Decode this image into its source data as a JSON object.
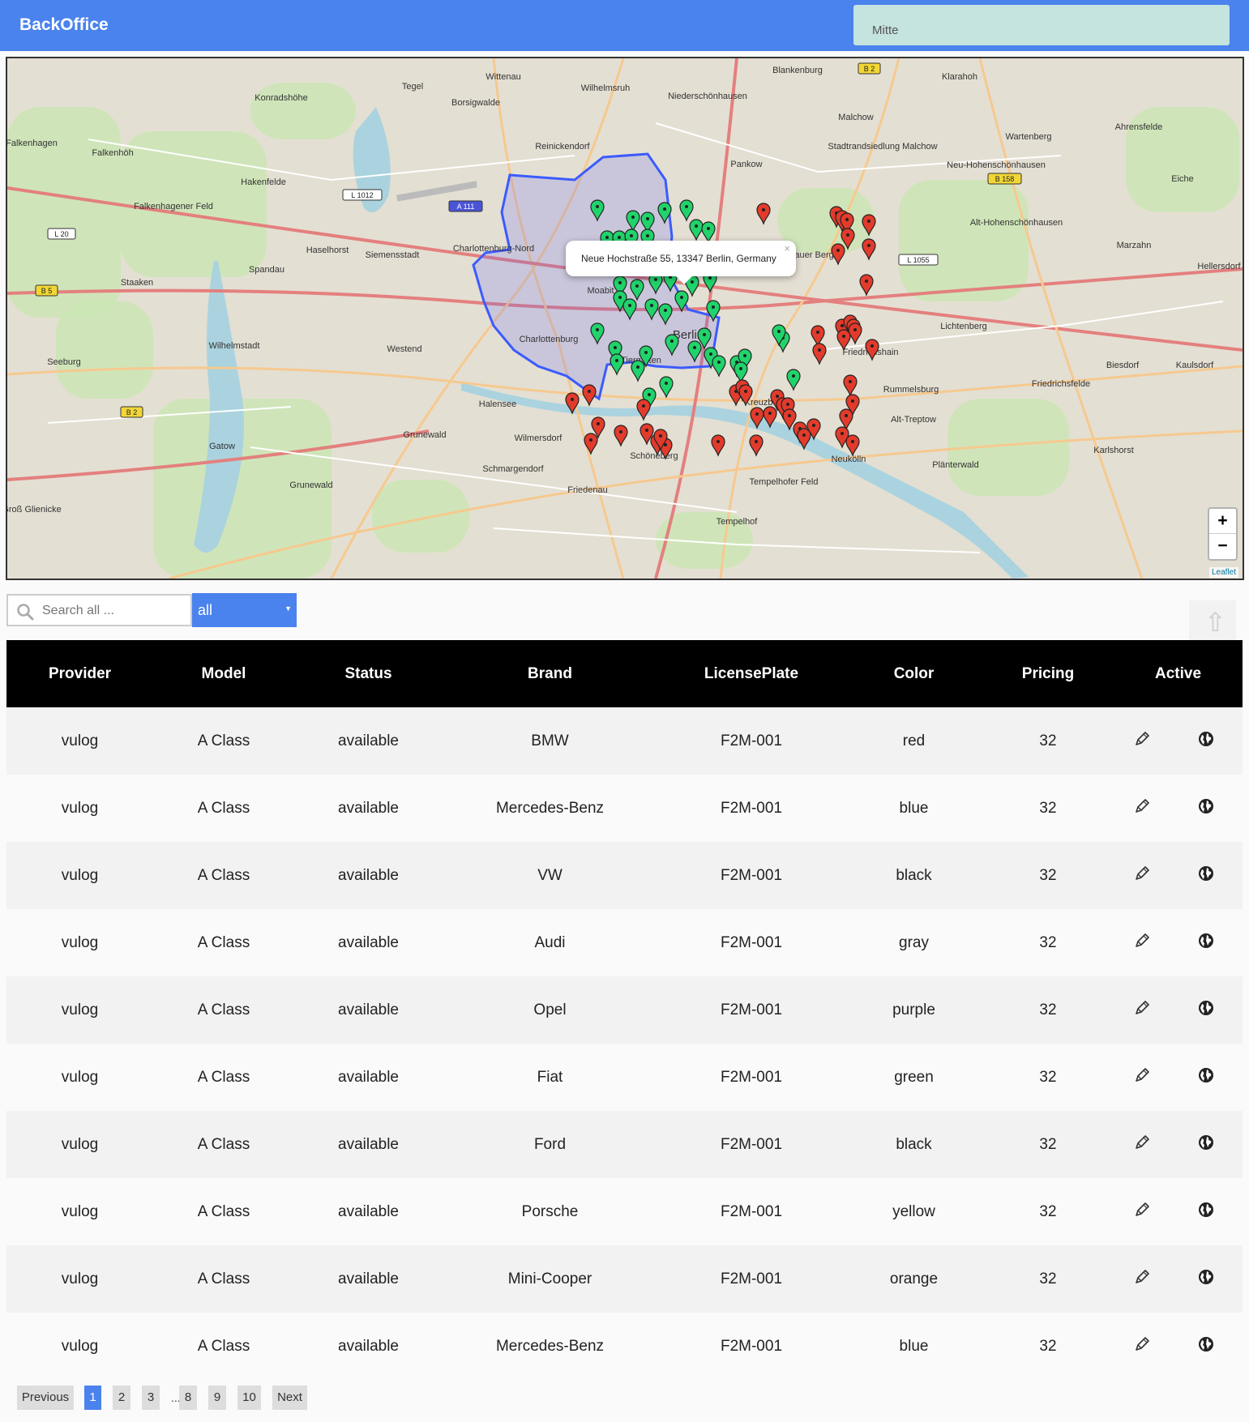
{
  "app": {
    "title": "BackOffice"
  },
  "district": {
    "value": "Mitte"
  },
  "map": {
    "popup_text": "Neue Hochstraße 55, 13347 Berlin, Germany",
    "popup_close": "×",
    "zoom_in": "+",
    "zoom_out": "−",
    "attribution": "Leaflet",
    "place_labels": [
      "Tegel",
      "Konradshöhe",
      "Wittenau",
      "Wilhelmsruh",
      "Blankenburg",
      "Klarahoh",
      "Borsigwalde",
      "Niederschönhausen",
      "Malchow",
      "Ahrensfelde",
      "Reinickendorf",
      "Wartenberg",
      "Falkenhagen",
      "Falkenhöh",
      "Stadtrandsiedlung Malchow",
      "Hakenfelde",
      "Pankow",
      "Neu-Hohenschönhausen",
      "Eiche",
      "Falkenhagener Feld",
      "Alt-Hohenschönhausen",
      "Haselhorst",
      "Siemensstadt",
      "Charlottenburg-Nord",
      "Marzahn",
      "Spandau",
      "Prenzlauer Berg",
      "Hellersdorf",
      "Staaken",
      "Moabit",
      "Lichtenberg",
      "Charlottenburg",
      "Berlin",
      "Friedrichshain",
      "Wilhelmstadt",
      "Westend",
      "Tiergarten",
      "Seeburg",
      "Biesdorf",
      "Kaulsdorf",
      "Rummelsburg",
      "Friedrichsfelde",
      "Halensee",
      "Kreuzberg",
      "Alt-Treptow",
      "Grunewald",
      "Gatow",
      "Wilmersdorf",
      "Karlshorst",
      "Schöneberg",
      "Neukölln",
      "Plänterwald",
      "Schmargendorf",
      "Friedenau",
      "Tempelhofer Feld",
      "Tempelhof",
      "Grunewald",
      "Groß Glienicke"
    ],
    "road_labels": [
      "L 1012",
      "L 20",
      "B 5",
      "A 111",
      "B 2",
      "B 158",
      "L 1055",
      "B 2"
    ],
    "markers": {
      "active_color": "#21d36b",
      "inactive_color": "#e23b2c",
      "selected_color": "#f4e33b"
    },
    "area_color": "#3b5bff"
  },
  "search": {
    "placeholder": "Search all ...",
    "value": ""
  },
  "filter": {
    "selected": "all"
  },
  "table": {
    "headers": [
      "Provider",
      "Model",
      "Status",
      "Brand",
      "LicensePlate",
      "Color",
      "Pricing",
      "Active"
    ],
    "rows": [
      [
        "vulog",
        "A Class",
        "available",
        "BMW",
        "F2M-001",
        "red",
        "32"
      ],
      [
        "vulog",
        "A Class",
        "available",
        "Mercedes-Benz",
        "F2M-001",
        "blue",
        "32"
      ],
      [
        "vulog",
        "A Class",
        "available",
        "VW",
        "F2M-001",
        "black",
        "32"
      ],
      [
        "vulog",
        "A Class",
        "available",
        "Audi",
        "F2M-001",
        "gray",
        "32"
      ],
      [
        "vulog",
        "A Class",
        "available",
        "Opel",
        "F2M-001",
        "purple",
        "32"
      ],
      [
        "vulog",
        "A Class",
        "available",
        "Fiat",
        "F2M-001",
        "green",
        "32"
      ],
      [
        "vulog",
        "A Class",
        "available",
        "Ford",
        "F2M-001",
        "black",
        "32"
      ],
      [
        "vulog",
        "A Class",
        "available",
        "Porsche",
        "F2M-001",
        "yellow",
        "32"
      ],
      [
        "vulog",
        "A Class",
        "available",
        "Mini-Cooper",
        "F2M-001",
        "orange",
        "32"
      ],
      [
        "vulog",
        "A Class",
        "available",
        "Mercedes-Benz",
        "F2M-001",
        "blue",
        "32"
      ]
    ],
    "row_icons": [
      "pencil-icon",
      "globe-icon"
    ]
  },
  "pagination": {
    "previous": "Previous",
    "pages": [
      "1",
      "2",
      "3",
      "8",
      "9",
      "10"
    ],
    "ellipsis": "...",
    "next": "Next",
    "current": "1"
  }
}
